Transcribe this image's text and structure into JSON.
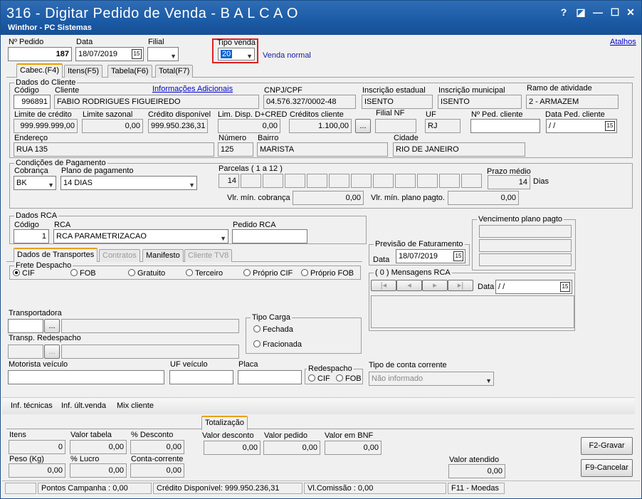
{
  "window": {
    "title": "316 - Digitar Pedido de Venda - B A L C A O",
    "subtitle": "Winthor - PC Sistemas",
    "btn_help": "?",
    "btn_edit": "◪",
    "btn_min": "—",
    "btn_max": "☐",
    "btn_close": "✕"
  },
  "header": {
    "pedido_label": "Nº Pedido",
    "pedido": "187",
    "data_label": "Data",
    "data": "18/07/2019",
    "filial_label": "Filial",
    "filial": "",
    "tipo_venda_label": "Tipo venda",
    "tipo_venda": "20",
    "tipo_venda_desc": "Venda normal",
    "atalhos": "Atalhos",
    "cal_icon": "15"
  },
  "tabs": [
    "Cabec.(F4)",
    "Itens(F5)",
    "Tabela(F6)",
    "Total(F7)"
  ],
  "cliente": {
    "group": "Dados do Cliente",
    "codigo_label": "Código",
    "codigo": "996891",
    "cliente_label": "Cliente",
    "cliente": "FABIO RODRIGUES FIGUEIREDO",
    "info_link": "Informações Adicionais",
    "cnpj_label": "CNPJ/CPF",
    "cnpj": "04.576.327/0002-48",
    "ie_label": "Inscrição estadual",
    "ie": "ISENTO",
    "im_label": "Inscrição municipal",
    "im": "ISENTO",
    "ramo_label": "Ramo de atividade",
    "ramo": "2 - ARMAZEM",
    "lim_label": "Limite de crédito",
    "lim": "999.999.999,00",
    "sazonal_label": "Limite sazonal",
    "sazonal": "0,00",
    "disp_label": "Crédito disponível",
    "disp": "999.950.236,31",
    "limdisp_label": "Lim. Disp. D+CRED",
    "limdisp": "0,00",
    "credcli_label": "Créditos cliente",
    "credcli": "1.100,00",
    "more": "...",
    "filialnf_label": "Filial NF",
    "filialnf": "",
    "uf_label": "UF",
    "uf": "RJ",
    "nped_label": "Nº Ped. cliente",
    "nped": "",
    "dataped_label": "Data Ped. cliente",
    "dataped": "/ /",
    "end_label": "Endereço",
    "end": "RUA 135",
    "num_label": "Número",
    "num": "125",
    "bairro_label": "Bairro",
    "bairro": "MARISTA",
    "cidade_label": "Cidade",
    "cidade": "RIO DE JANEIRO"
  },
  "pagamento": {
    "group": "Condições de Pagamento",
    "cob_label": "Cobrança",
    "cob": "BK",
    "plano_label": "Plano de pagamento",
    "plano": "14 DIAS",
    "parcelas_label": "Parcelas ( 1 a 12 )",
    "parcela1": "14",
    "prazo_label": "Prazo médio",
    "prazo": "14",
    "dias": "Dias",
    "vmincob_label": "Vlr. mín. cobrança",
    "vmincob": "0,00",
    "vminplano_label": "Vlr. mín. plano pagto.",
    "vminplano": "0,00"
  },
  "rca": {
    "group": "Dados RCA",
    "codigo_label": "Código",
    "codigo": "1",
    "rca_label": "RCA",
    "rca": "RCA PARAMETRIZACAO",
    "pedido_label": "Pedido RCA",
    "pedido": ""
  },
  "venc": {
    "group": "Vencimento plano pagto"
  },
  "previsao": {
    "group": "Previsão de Faturamento",
    "data_label": "Data",
    "data": "18/07/2019"
  },
  "mensagens": {
    "group": "( 0 ) Mensagens RCA",
    "data_label": "Data",
    "data": "/ /"
  },
  "subtabs": [
    "Dados de Transportes",
    "Contratos",
    "Manifesto",
    "Cliente TV8"
  ],
  "frete": {
    "group": "Frete Despacho",
    "options": [
      "CIF",
      "FOB",
      "Gratuito",
      "Terceiro",
      "Próprio CIF",
      "Próprio FOB"
    ]
  },
  "transp": {
    "transp_label": "Transportadora",
    "redesp_label": "Transp. Redespacho",
    "more": "..."
  },
  "carga": {
    "group": "Tipo Carga",
    "fechada": "Fechada",
    "fracionada": "Fracionada"
  },
  "veiculo": {
    "motorista_label": "Motorista veículo",
    "uf_label": "UF veículo",
    "placa_label": "Placa",
    "redesp_group": "Redespacho",
    "cif": "CIF",
    "fob": "FOB",
    "conta_label": "Tipo de conta corrente",
    "conta": "Não informado"
  },
  "links": [
    "Inf. técnicas",
    "Inf. últ.venda",
    "Mix cliente"
  ],
  "totalizacao": {
    "tab": "Totalização",
    "itens_label": "Itens",
    "itens": "0",
    "vtab_label": "Valor tabela",
    "vtab": "0,00",
    "pdesc_label": "% Desconto",
    "pdesc": "0,00",
    "vdesc_label": "Valor desconto",
    "vdesc": "0,00",
    "vped_label": "Valor pedido",
    "vped": "0,00",
    "vbnf_label": "Valor em BNF",
    "vbnf": "0,00",
    "peso_label": "Peso (Kg)",
    "peso": "0,00",
    "lucro_label": "% Lucro",
    "lucro": "0,00",
    "cc_label": "Conta-corrente",
    "cc": "0,00",
    "vat_label": "Valor atendido",
    "vat": "0,00",
    "gravar": "F2-Gravar",
    "cancelar": "F9-Cancelar"
  },
  "status": {
    "pontos": "Pontos Campanha : 0,00",
    "credito": "Crédito Disponível: 999.950.236,31",
    "comissao": "Vl.Comissão : 0,00",
    "moedas": "F11 - Moedas"
  },
  "colors": {
    "titlebar": "#1b5aa5",
    "highlight": "#e02020",
    "link": "#0000cc"
  }
}
